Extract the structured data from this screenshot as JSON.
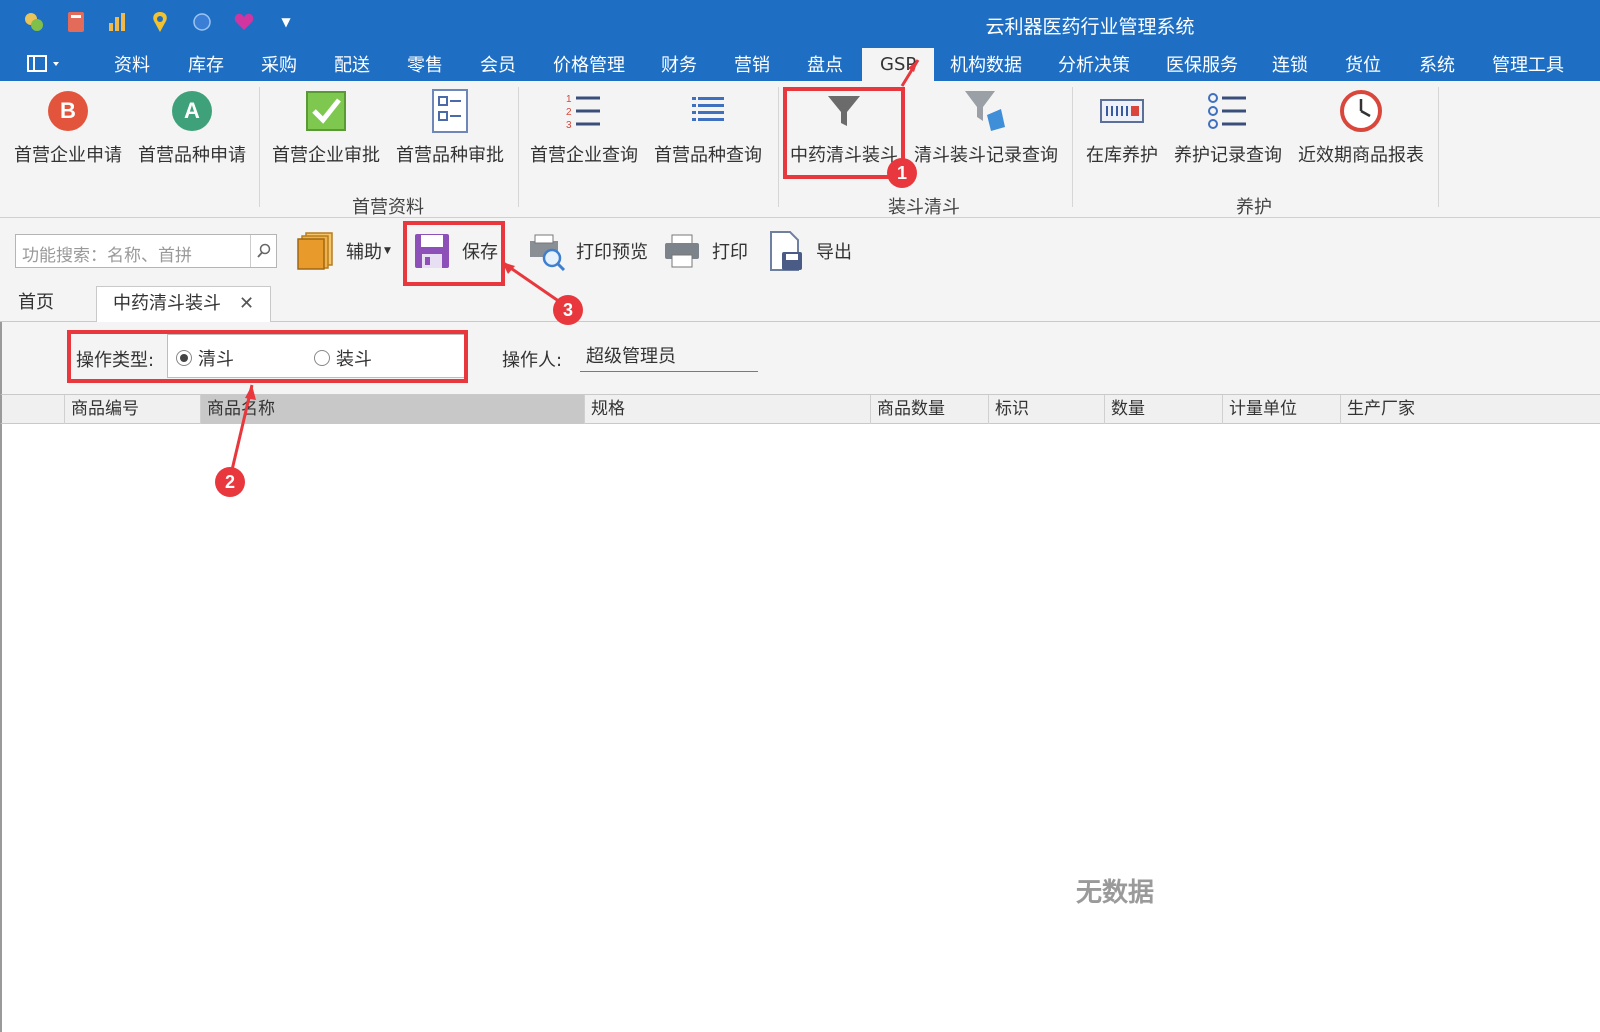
{
  "window": {
    "title": "云利器医药行业管理系统"
  },
  "quick_access": [
    "coins-icon",
    "book-icon",
    "chart-icon",
    "location-pin-icon",
    "globe-icon",
    "heart-icon",
    "dropdown-arrow-icon"
  ],
  "menu": {
    "items": [
      "资料",
      "库存",
      "采购",
      "配送",
      "零售",
      "会员",
      "价格管理",
      "财务",
      "营销",
      "盘点",
      "GSP",
      "机构数据",
      "分析决策",
      "医保服务",
      "连锁",
      "货位",
      "系统",
      "管理工具"
    ],
    "active": "GSP"
  },
  "ribbon": {
    "groups": [
      {
        "label": "首营资料",
        "buttons": [
          "首营企业申请",
          "首营品种申请",
          "首营企业审批",
          "首营品种审批",
          "首营企业查询",
          "首营品种查询"
        ]
      },
      {
        "label": "装斗清斗",
        "buttons": [
          "中药清斗装斗",
          "清斗装斗记录查询"
        ]
      },
      {
        "label": "养护",
        "buttons": [
          "在库养护",
          "养护记录查询",
          "近效期商品报表"
        ]
      }
    ],
    "icon_letters": {
      "b": "B",
      "a": "A"
    }
  },
  "toolbar": {
    "search_placeholder": "功能搜索：名称、首拼",
    "assist": "辅助",
    "save": "保存",
    "print_preview": "打印预览",
    "print": "打印",
    "export": "导出"
  },
  "tabs": {
    "home": "首页",
    "current": "中药清斗装斗",
    "close": "✕"
  },
  "form": {
    "op_type_label": "操作类型:",
    "options": [
      "清斗",
      "装斗"
    ],
    "selected": "清斗",
    "operator_label": "操作人:",
    "operator_value": "超级管理员"
  },
  "grid": {
    "columns": [
      "商品编号",
      "商品名称",
      "规格",
      "商品数量",
      "标识",
      "数量",
      "计量单位",
      "生产厂家"
    ],
    "empty_text": "无数据"
  },
  "annotations": {
    "badges": [
      "1",
      "2",
      "3"
    ],
    "color": "#e8383d"
  },
  "colors": {
    "title_bar": "#1e6fc4",
    "ribbon_bg": "#f4f4f4"
  }
}
